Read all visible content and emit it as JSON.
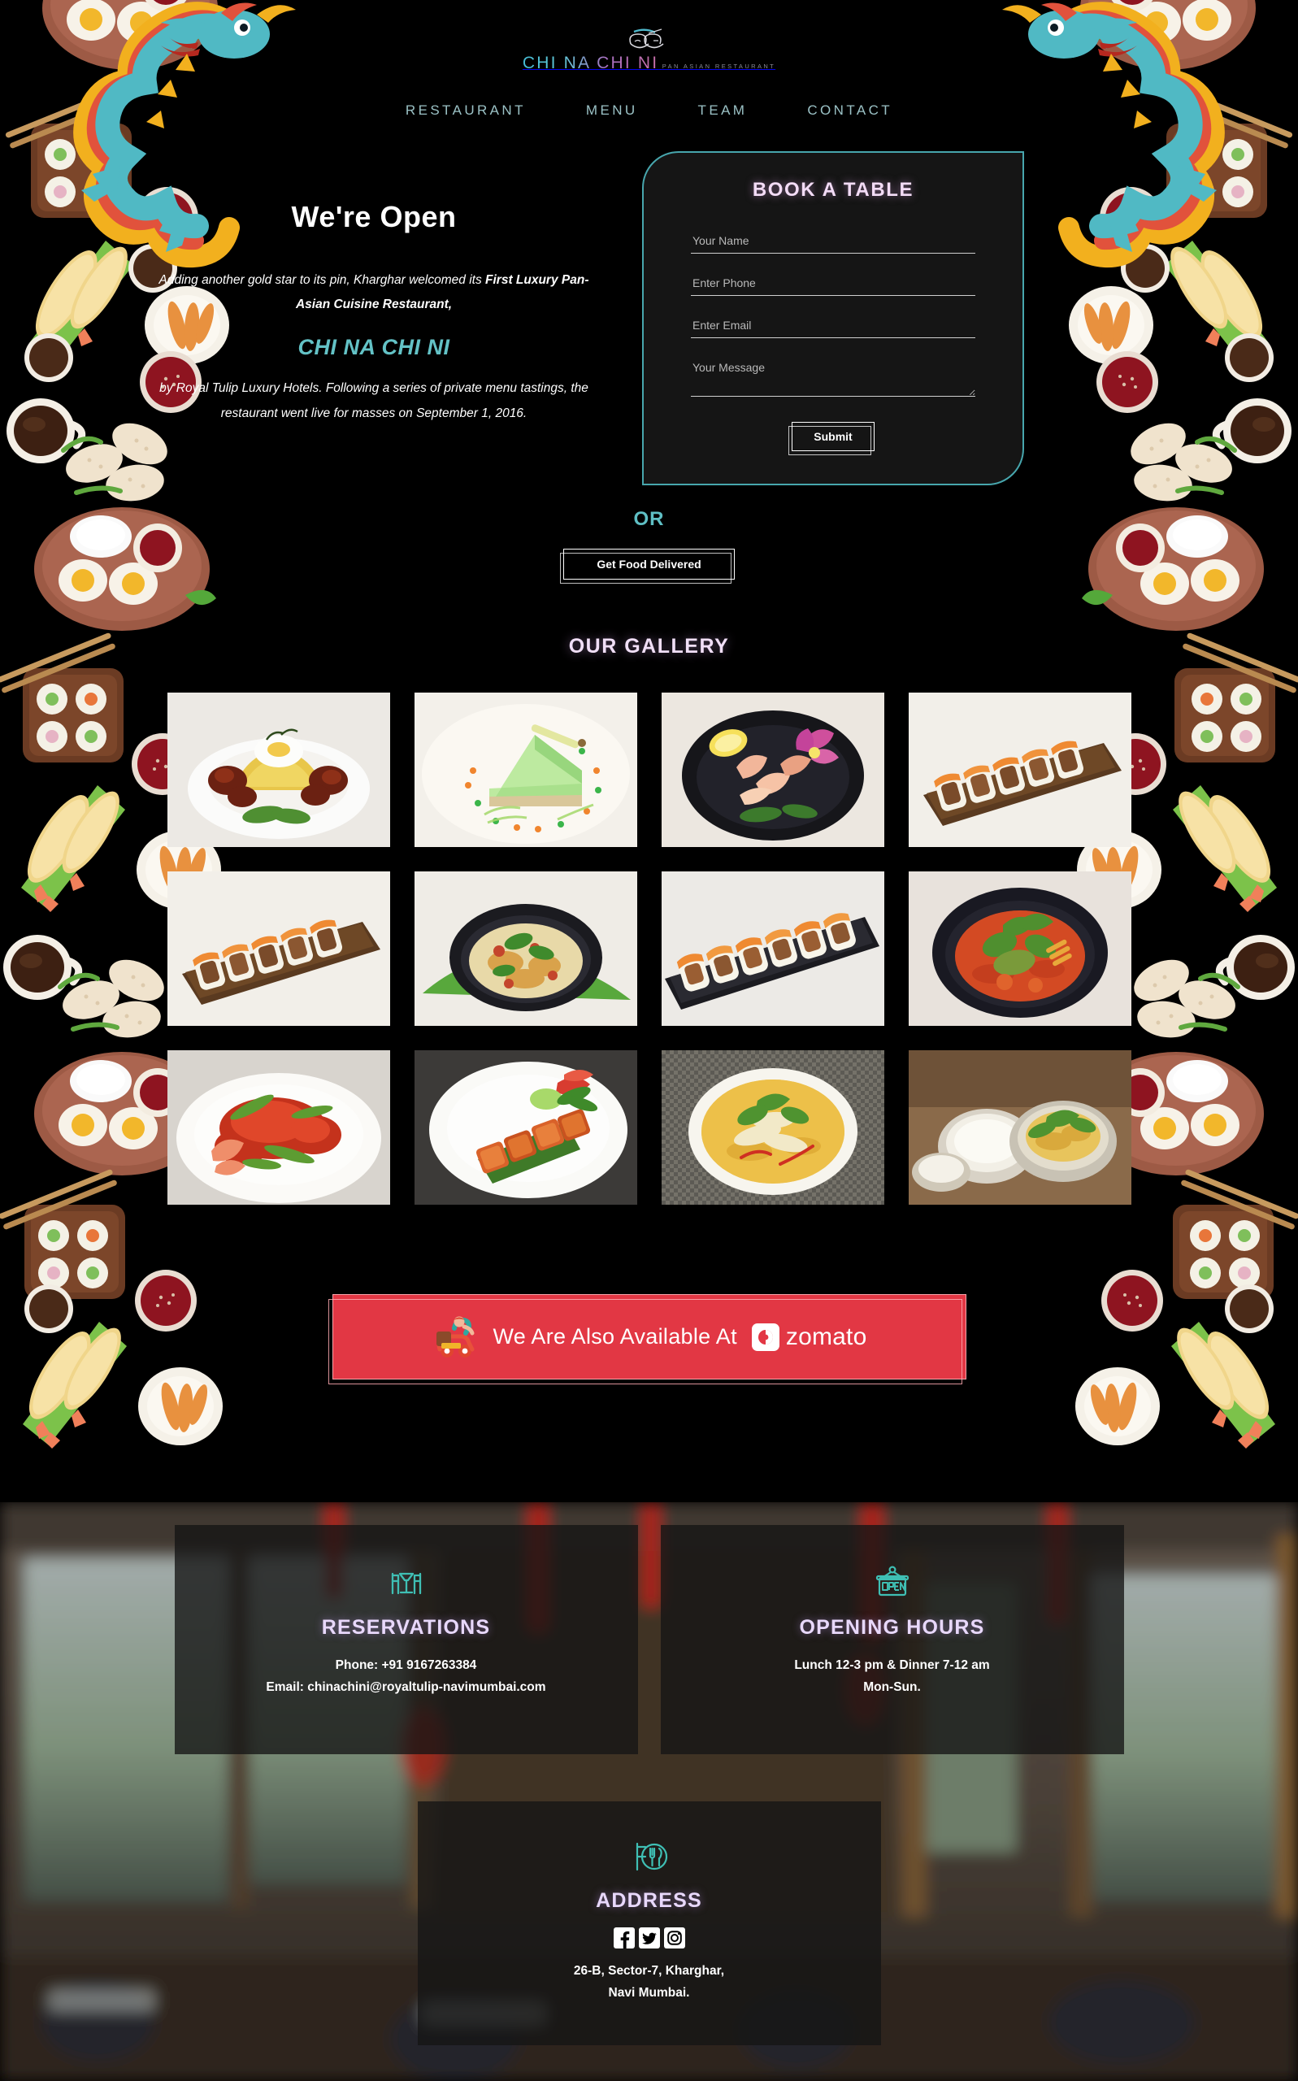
{
  "brand": {
    "logo_text": "CHI NA CHI NI",
    "logo_subtitle": "PAN ASIAN RESTAURANT",
    "accent_teal": "#47a6ad",
    "accent_pink": "#f3dcf6",
    "zomato_red": "#e23744"
  },
  "nav": {
    "items": [
      {
        "label": "RESTAURANT"
      },
      {
        "label": "MENU"
      },
      {
        "label": "TEAM"
      },
      {
        "label": "CONTACT"
      }
    ]
  },
  "hero": {
    "title": "We're Open",
    "paragraph_1_plain": "Adding another gold star to its pin, Kharghar welcomed its ",
    "paragraph_1_bold": "First Luxury Pan-Asian Cuisine Restaurant,",
    "brand_name": "CHI NA CHI NI",
    "paragraph_2": "by Royal Tulip Luxury Hotels. Following a series of private menu tastings, the restaurant went live for masses on September 1, 2016."
  },
  "booking": {
    "title": "BOOK A TABLE",
    "fields": [
      {
        "name": "your-name",
        "placeholder": "Your Name",
        "value": ""
      },
      {
        "name": "phone",
        "placeholder": "Enter Phone",
        "value": ""
      },
      {
        "name": "email",
        "placeholder": "Enter Email",
        "value": ""
      },
      {
        "name": "message",
        "placeholder": "Your Message",
        "value": ""
      }
    ],
    "submit_label": "Submit",
    "or_label": "OR",
    "delivery_label": "Get Food Delivered"
  },
  "gallery": {
    "title": "OUR GALLERY",
    "items": [
      {
        "caption": "Crispy lamb with yellow fried rice and poached egg"
      },
      {
        "caption": "Green pandan cheesecake slice with sauce dots"
      },
      {
        "caption": "Sashimi platter with orchid and lemon in black bowl"
      },
      {
        "caption": "Maki sushi roll line on wooden slate board"
      },
      {
        "caption": "Maki sushi roll line on wooden slate board"
      },
      {
        "caption": "Thai seafood curry bowl with herbs on banana leaf"
      },
      {
        "caption": "Tobiko topped sushi rolls on black rectangular plate"
      },
      {
        "caption": "Red Thai curry with coriander in dark bowl"
      },
      {
        "caption": "Chilli crab in red sauce with spring onion"
      },
      {
        "caption": "Tandoori paneer tikka skewer on banana leaf"
      },
      {
        "caption": "Yellow coconut curry with chilli drizzle"
      },
      {
        "caption": "Biryani with raita served in copper bowls"
      }
    ]
  },
  "zomato": {
    "text": "We Are Also Available At",
    "logo_word": "zomato",
    "scooter_icon": "delivery-scooter-icon"
  },
  "footer": {
    "reservations": {
      "icon": "dining-table-icon",
      "title": "RESERVATIONS",
      "phone": "Phone: +91 9167263384",
      "email": "Email: chinachini@royaltulip-navimumbai.com"
    },
    "opening_hours": {
      "icon": "open-sign-icon",
      "title": "OPENING HOURS",
      "line_1": "Lunch 12-3 pm & Dinner 7-12 am",
      "line_2": "Mon-Sun."
    },
    "address": {
      "icon": "plate-cutlery-sign-icon",
      "title": "ADDRESS",
      "socials": [
        {
          "name": "facebook-icon"
        },
        {
          "name": "twitter-icon"
        },
        {
          "name": "instagram-icon"
        }
      ],
      "line_1": "26-B, Sector-7, Kharghar,",
      "line_2": "Navi Mumbai."
    }
  }
}
